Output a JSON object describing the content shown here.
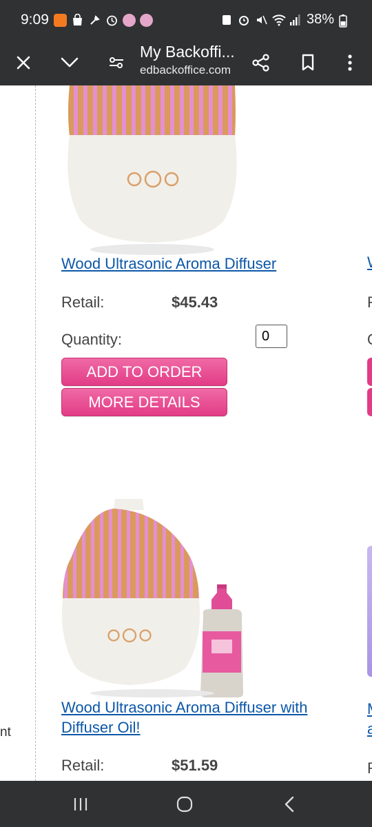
{
  "status_bar": {
    "time": "9:09",
    "battery": "38%"
  },
  "browser": {
    "title": "My Backoffi...",
    "domain": "edbackoffice.com"
  },
  "left_column": {
    "cut_text": "nt"
  },
  "products": [
    {
      "title": "Wood Ultrasonic Aroma Diffuser",
      "retail_label": "Retail:",
      "price": "$45.43",
      "quantity_label": "Quantity:",
      "quantity_value": "0",
      "add_label": "ADD TO ORDER",
      "details_label": "MORE DETAILS"
    },
    {
      "title": "Wood Ultrasonic Aroma Diffuser with Diffuser Oil!",
      "retail_label": "Retail:",
      "price": "$51.59"
    }
  ],
  "next_column": {
    "title_cut_1": "W",
    "label_cut_1": "R",
    "label_cut_2": "Q",
    "title_cut_2a": "M",
    "title_cut_2b": "a",
    "label_cut_3": "R"
  },
  "colors": {
    "bar_bg": "#303133",
    "link": "#0b57a8",
    "button_pink": "#e23c86"
  }
}
